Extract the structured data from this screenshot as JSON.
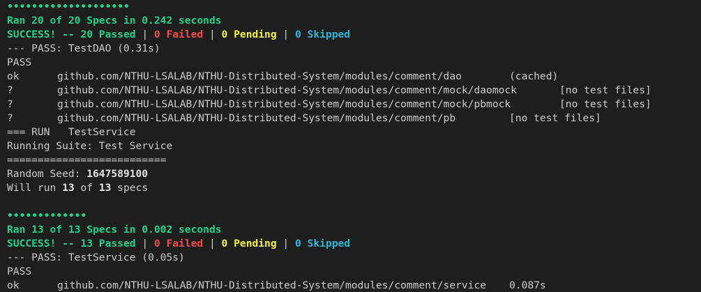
{
  "colors": {
    "background": "#1e1e1e",
    "text": "#cccccc",
    "success_green": "#23d18b",
    "failed_red": "#f14c4c",
    "pending_yellow": "#f5f543",
    "skipped_cyan": "#29b8db"
  },
  "suite1": {
    "dots": "••••••••••••••••••••",
    "ran_line": "Ran 20 of 20 Specs in 0.242 seconds",
    "success": "SUCCESS!",
    "sep1": " -- ",
    "passed": "20 Passed",
    "pipe": " | ",
    "failed": "0 Failed",
    "pending": "0 Pending",
    "skipped": "0 Skipped",
    "pass_test": "--- PASS: TestDAO (0.31s)",
    "pass": "PASS"
  },
  "packages": [
    {
      "status": "ok",
      "path": "github.com/NTHU-LSALAB/NTHU-Distributed-System/modules/comment/dao",
      "note": "(cached)"
    },
    {
      "status": "?",
      "path": "github.com/NTHU-LSALAB/NTHU-Distributed-System/modules/comment/mock/daomock",
      "note": "[no test files]"
    },
    {
      "status": "?",
      "path": "github.com/NTHU-LSALAB/NTHU-Distributed-System/modules/comment/mock/pbmock",
      "note": "[no test files]"
    },
    {
      "status": "?",
      "path": "github.com/NTHU-LSALAB/NTHU-Distributed-System/modules/comment/pb",
      "note": "[no test files]"
    }
  ],
  "run": {
    "run_line": "=== RUN   TestService",
    "suite_line": "Running Suite: Test Service",
    "underline": "==========================",
    "seed_label": "Random Seed: ",
    "seed_value": "1647589100",
    "will_run_prefix": "Will run ",
    "will_run_count": "13",
    "will_run_mid": " of ",
    "will_run_total": "13",
    "will_run_suffix": " specs"
  },
  "suite2": {
    "dots": "•••••••••••••",
    "ran_line": "Ran 13 of 13 Specs in 0.002 seconds",
    "success": "SUCCESS!",
    "sep1": " -- ",
    "passed": "13 Passed",
    "pipe": " | ",
    "failed": "0 Failed",
    "pending": "0 Pending",
    "skipped": "0 Skipped",
    "pass_test": "--- PASS: TestService (0.05s)",
    "pass": "PASS"
  },
  "final_package": {
    "status": "ok",
    "path": "github.com/NTHU-LSALAB/NTHU-Distributed-System/modules/comment/service",
    "duration": "0.087s"
  }
}
